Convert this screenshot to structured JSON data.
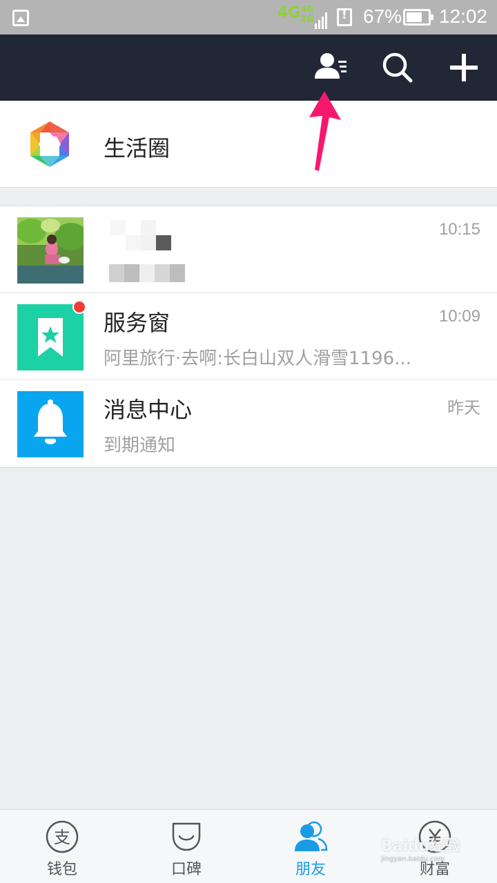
{
  "status_bar": {
    "network_primary": "4G",
    "network_secondary_top": "4G",
    "network_secondary_bottom": "2G",
    "battery": "67%",
    "time": "12:02"
  },
  "header": {
    "icons": [
      "contacts-icon",
      "search-icon",
      "add-icon"
    ]
  },
  "life_circle": {
    "label": "生活圈"
  },
  "conversations": [
    {
      "title": "",
      "subtitle": "",
      "time": "10:15",
      "avatar": "user-photo",
      "blurred": true
    },
    {
      "title": "服务窗",
      "subtitle": "阿里旅行·去啊:长白山双人滑雪1196...",
      "time": "10:09",
      "avatar": "bookmark-star-icon",
      "avatar_color": "#1bd1a5",
      "unread_dot": true
    },
    {
      "title": "消息中心",
      "subtitle": "到期通知",
      "time": "昨天",
      "avatar": "bell-icon",
      "avatar_color": "#0aa5ef"
    }
  ],
  "bottom_nav": {
    "items": [
      {
        "label": "钱包",
        "icon": "wallet-icon"
      },
      {
        "label": "口碑",
        "icon": "koubei-icon"
      },
      {
        "label": "朋友",
        "icon": "friends-icon",
        "active": true
      },
      {
        "label": "财富",
        "icon": "wealth-icon"
      }
    ]
  },
  "watermark": {
    "text": "Baidu经验",
    "sub": "jingyan.baidu.com"
  },
  "colors": {
    "header_bg": "#222736",
    "accent": "#1a9be6",
    "arrow": "#f5196e",
    "badge": "#f23c33"
  }
}
